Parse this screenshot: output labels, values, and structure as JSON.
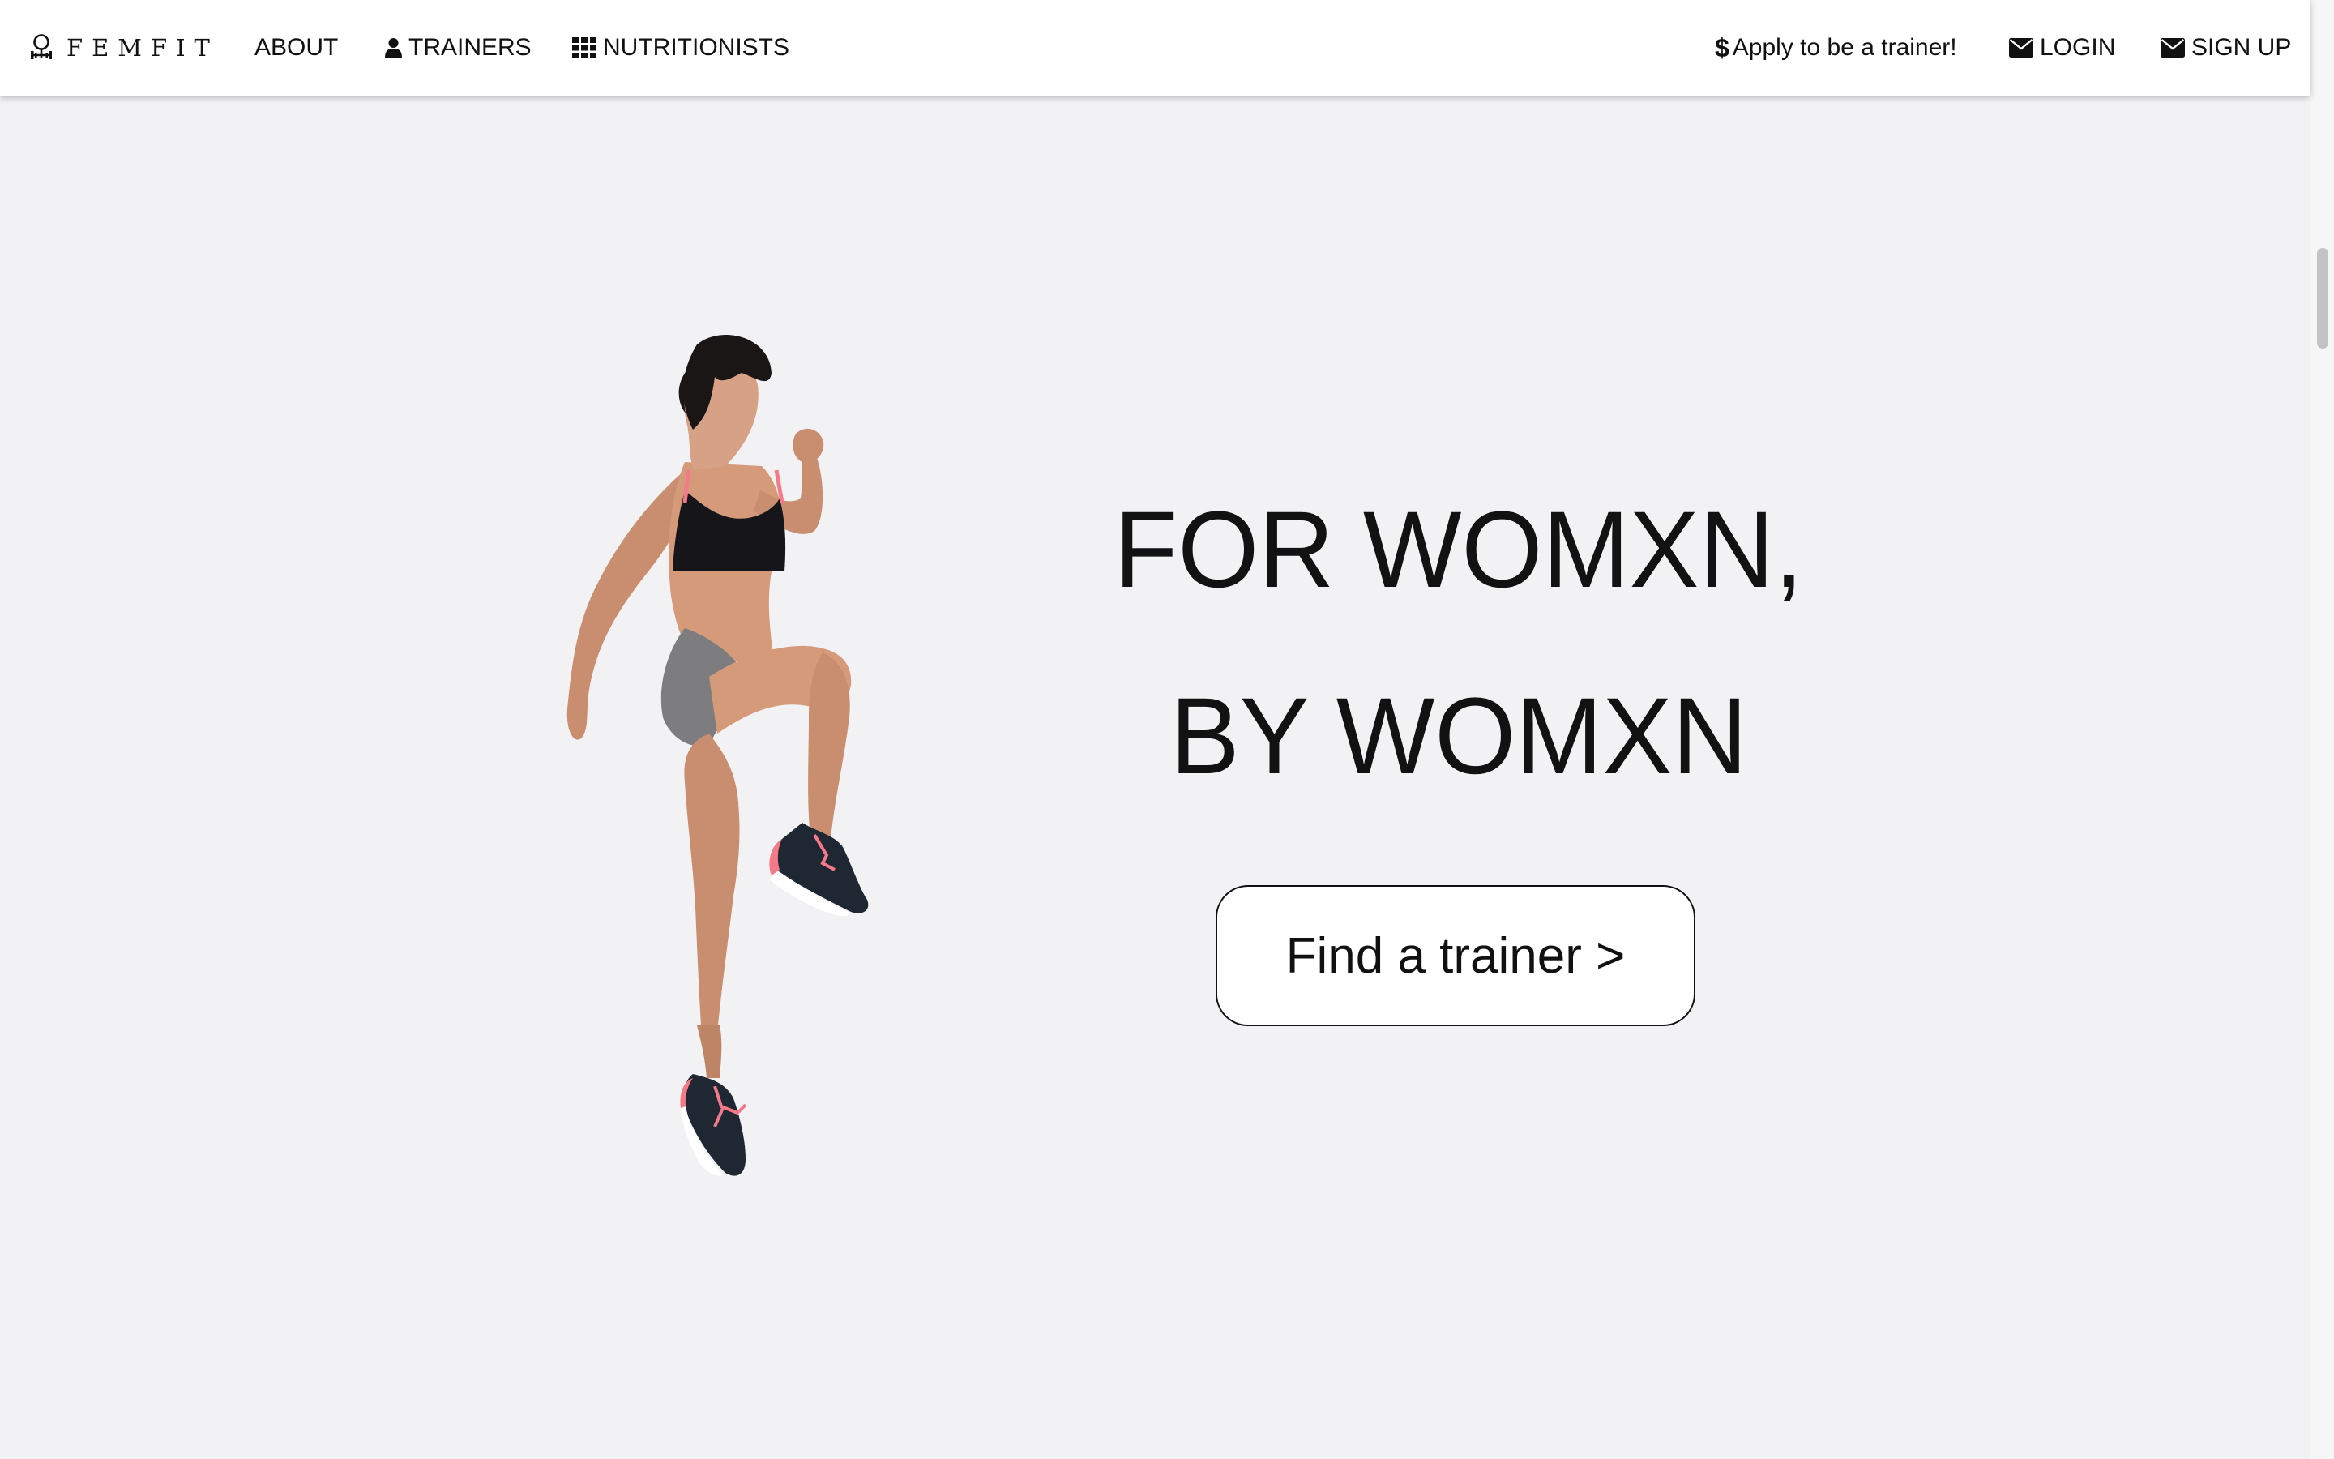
{
  "brand": {
    "name": "FEMFIT",
    "icon": "female-dumbbell-logo"
  },
  "nav": {
    "about": "ABOUT",
    "trainers": "TRAINERS",
    "nutritionists": "NUTRITIONISTS",
    "apply": "Apply to be a trainer!",
    "login": "LOGIN",
    "signup": "SIGN UP"
  },
  "icons": {
    "trainers": "user-icon",
    "nutritionists": "grid-icon",
    "apply": "dollar-icon",
    "login": "envelope-icon",
    "signup": "envelope-icon"
  },
  "hero": {
    "line1": "FOR WOMXN,",
    "line2": "BY WOMXN",
    "cta": "Find a trainer >"
  },
  "colors": {
    "background": "#f2f2f4",
    "navbar": "#ffffff",
    "text": "#111111",
    "shoe_accent": "#f47a8a"
  }
}
